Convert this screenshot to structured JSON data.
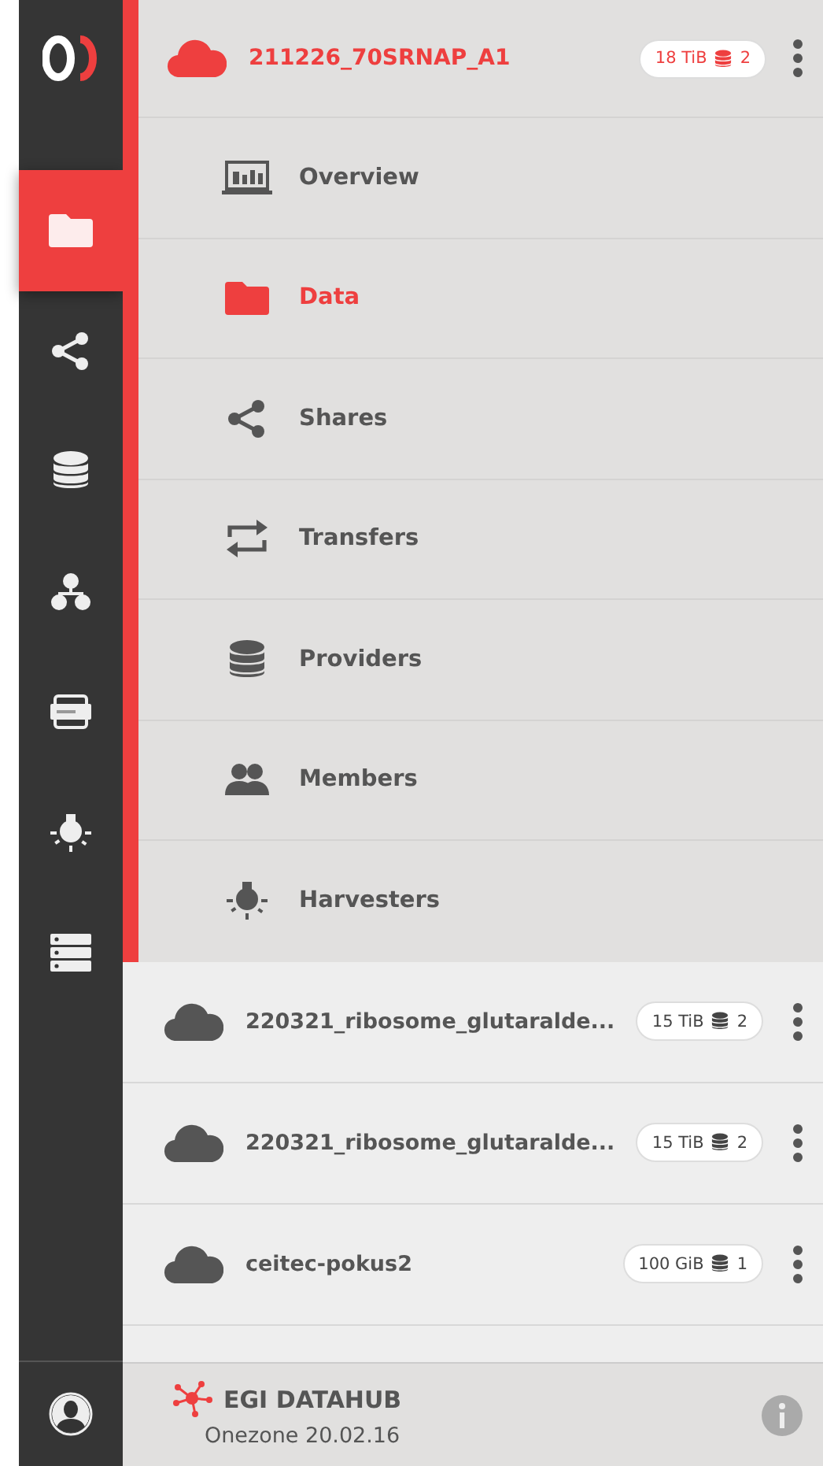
{
  "sidebar": {
    "items": [
      {
        "kind": "folder",
        "selected": true
      },
      {
        "kind": "share",
        "selected": false
      },
      {
        "kind": "database",
        "selected": false
      },
      {
        "kind": "cluster",
        "selected": false
      },
      {
        "kind": "token",
        "selected": false
      },
      {
        "kind": "bulb",
        "selected": false
      },
      {
        "kind": "server",
        "selected": false
      }
    ]
  },
  "active_space": {
    "name": "211226_70SRNAP_A1",
    "size": "18 TiB",
    "providers": "2",
    "menu": [
      {
        "kind": "overview",
        "label": "Overview",
        "selected": false
      },
      {
        "kind": "folder",
        "label": "Data",
        "selected": true
      },
      {
        "kind": "share",
        "label": "Shares",
        "selected": false
      },
      {
        "kind": "transfers",
        "label": "Transfers",
        "selected": false
      },
      {
        "kind": "database",
        "label": "Providers",
        "selected": false
      },
      {
        "kind": "members",
        "label": "Members",
        "selected": false
      },
      {
        "kind": "bulb",
        "label": "Harvesters",
        "selected": false
      }
    ]
  },
  "spaces": [
    {
      "name": "220321_ribosome_glutaralde...",
      "size": "15 TiB",
      "providers": "2"
    },
    {
      "name": "220321_ribosome_glutaralde...",
      "size": "15 TiB",
      "providers": "2"
    },
    {
      "name": "ceitec-pokus2",
      "size": "100 GiB",
      "providers": "1"
    }
  ],
  "footer": {
    "title": "EGI DATAHUB",
    "version": "Onezone 20.02.16"
  }
}
